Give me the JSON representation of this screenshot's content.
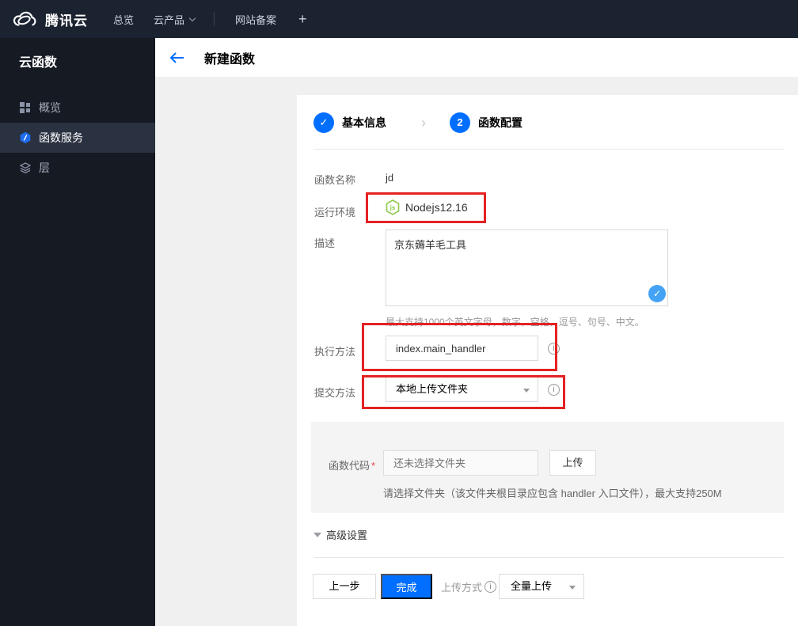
{
  "icons": {
    "check": "✓",
    "chevron": "›",
    "info": "i"
  },
  "topnav": {
    "brand": "腾讯云",
    "overview": "总览",
    "products": "云产品",
    "beian": "网站备案",
    "plus": "+"
  },
  "sidebar": {
    "title": "云函数",
    "items": [
      {
        "label": "概览"
      },
      {
        "label": "函数服务"
      },
      {
        "label": "层"
      }
    ]
  },
  "header": {
    "title": "新建函数"
  },
  "steps": {
    "step1_label": "基本信息",
    "step2_num": "2",
    "step2_label": "函数配置"
  },
  "form": {
    "name_label": "函数名称",
    "name_value": "jd",
    "runtime_label": "运行环境",
    "runtime_value": "Nodejs12.16",
    "desc_label": "描述",
    "desc_value": "京东薅羊毛工具",
    "desc_hint": "最大支持1000个英文字母，数字，空格，逗号、句号、中文。",
    "handler_label": "执行方法",
    "handler_value": "index.main_handler",
    "submit_label": "提交方法",
    "submit_value": "本地上传文件夹"
  },
  "code": {
    "label": "函数代码",
    "required_mark": "*",
    "placeholder": "还未选择文件夹",
    "upload_button": "上传",
    "hint": "请选择文件夹（该文件夹根目录应包含 handler 入口文件），最大支持250M"
  },
  "advanced": {
    "label": "高级设置"
  },
  "footer": {
    "prev": "上一步",
    "finish": "完成",
    "upload_mode_label": "上传方式",
    "upload_mode_value": "全量上传"
  },
  "colors": {
    "accent_blue": "#006eff",
    "badge_blue": "#45a3f5",
    "node_green": "#8cc84b",
    "annotation_red": "#e52222",
    "nav_bg": "#1b2230",
    "sidebar_bg": "#151a23"
  }
}
